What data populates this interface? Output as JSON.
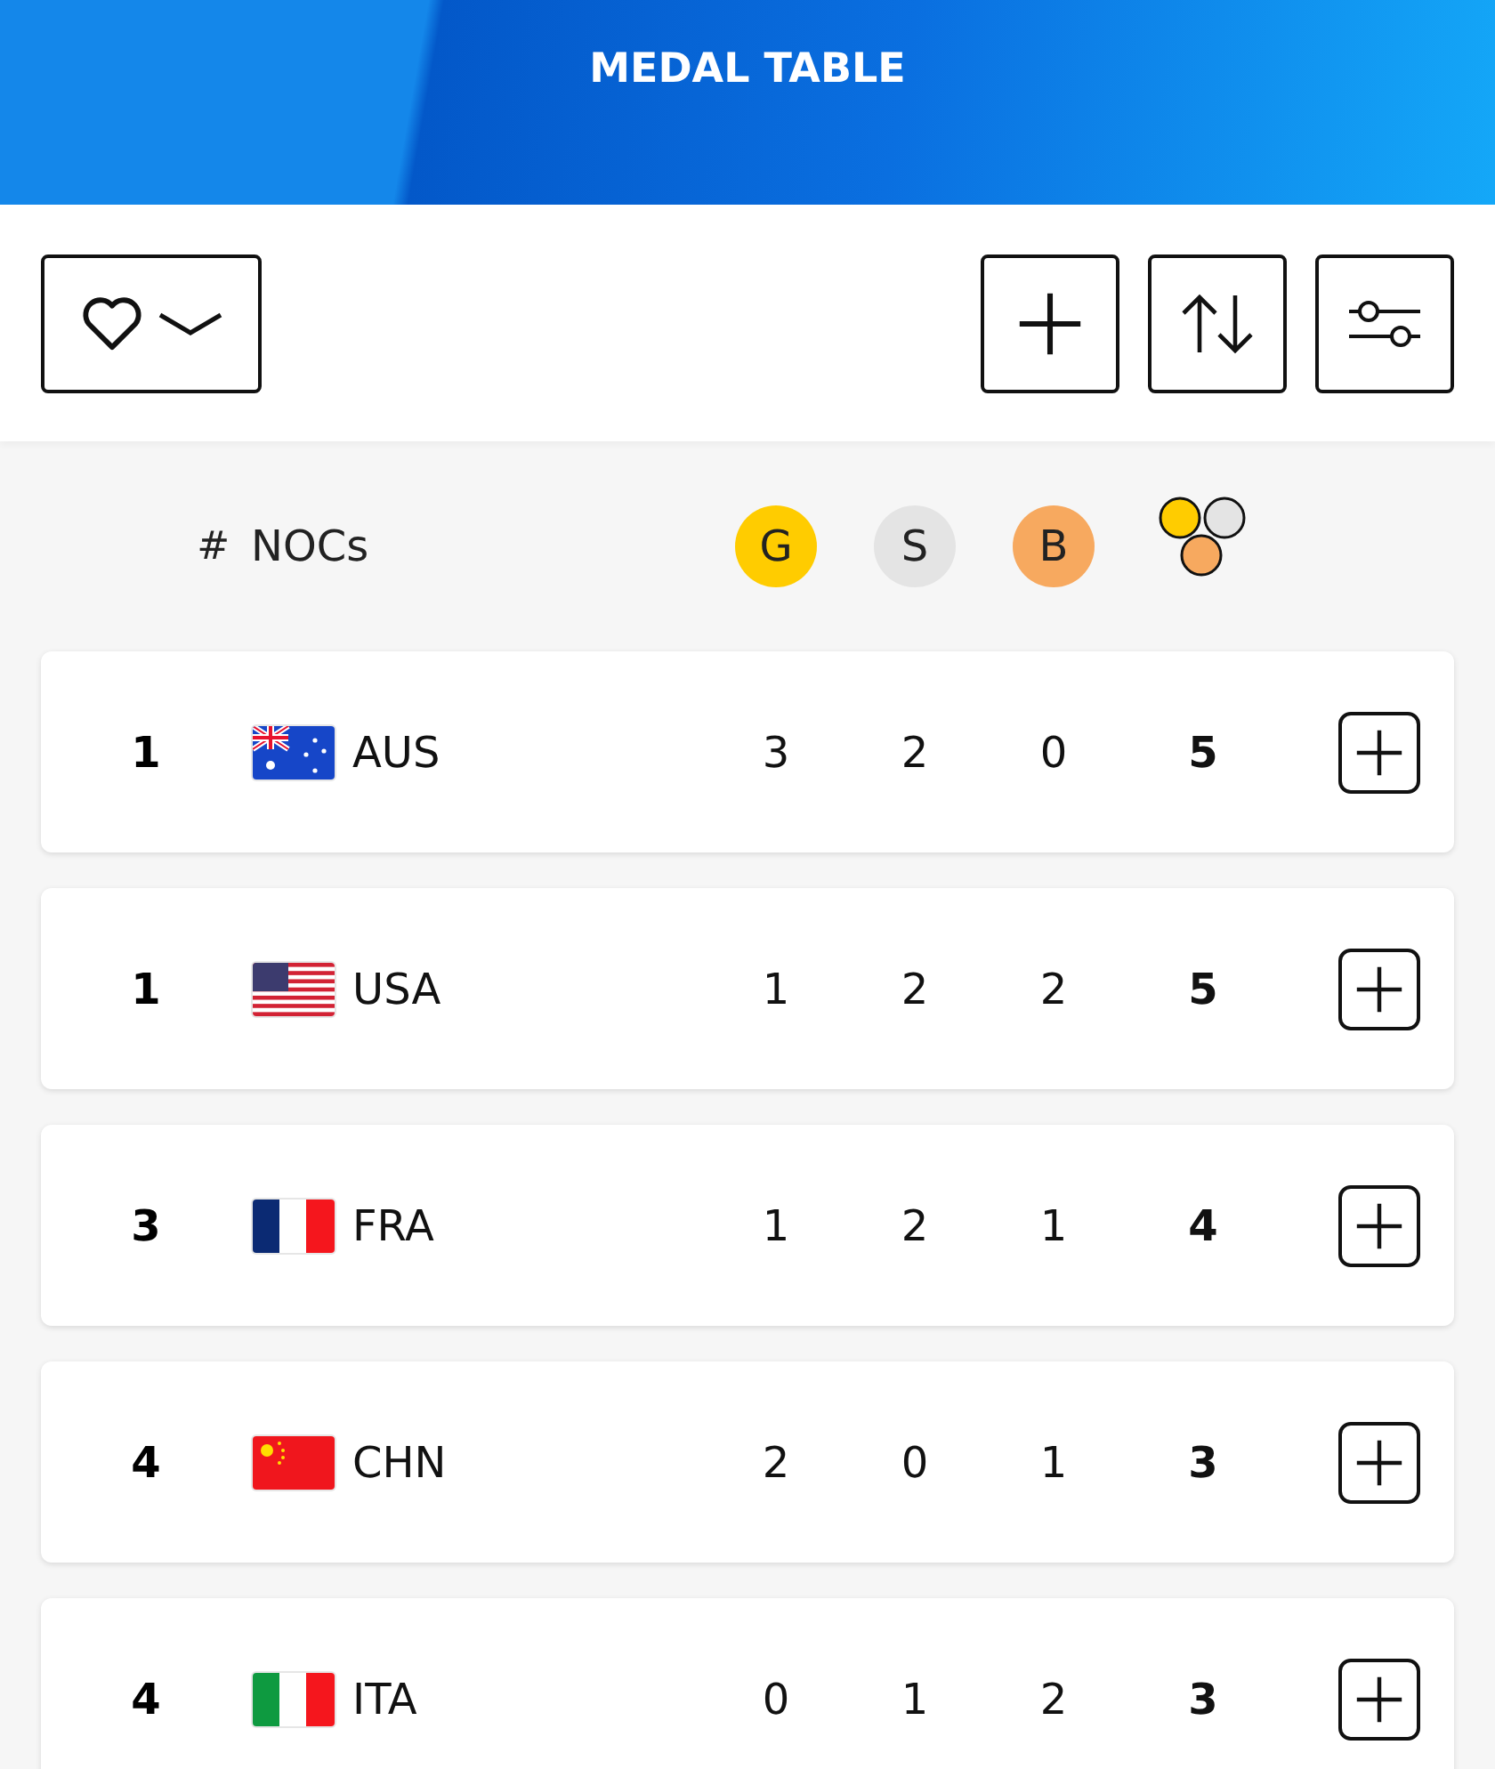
{
  "header": {
    "title": "MEDAL TABLE"
  },
  "columns": {
    "rank": "#",
    "noc": "NOCs",
    "gold": "G",
    "silver": "S",
    "bronze": "B"
  },
  "rows": [
    {
      "rank": "1",
      "kind": "aus",
      "code": "AUS",
      "gold": "3",
      "silver": "2",
      "bronze": "0",
      "total": "5"
    },
    {
      "rank": "1",
      "kind": "usa",
      "code": "USA",
      "gold": "1",
      "silver": "2",
      "bronze": "2",
      "total": "5"
    },
    {
      "rank": "3",
      "kind": "fra",
      "code": "FRA",
      "gold": "1",
      "silver": "2",
      "bronze": "1",
      "total": "4"
    },
    {
      "rank": "4",
      "kind": "chn",
      "code": "CHN",
      "gold": "2",
      "silver": "0",
      "bronze": "1",
      "total": "3"
    },
    {
      "rank": "4",
      "kind": "ita",
      "code": "ITA",
      "gold": "0",
      "silver": "1",
      "bronze": "2",
      "total": "3"
    }
  ]
}
